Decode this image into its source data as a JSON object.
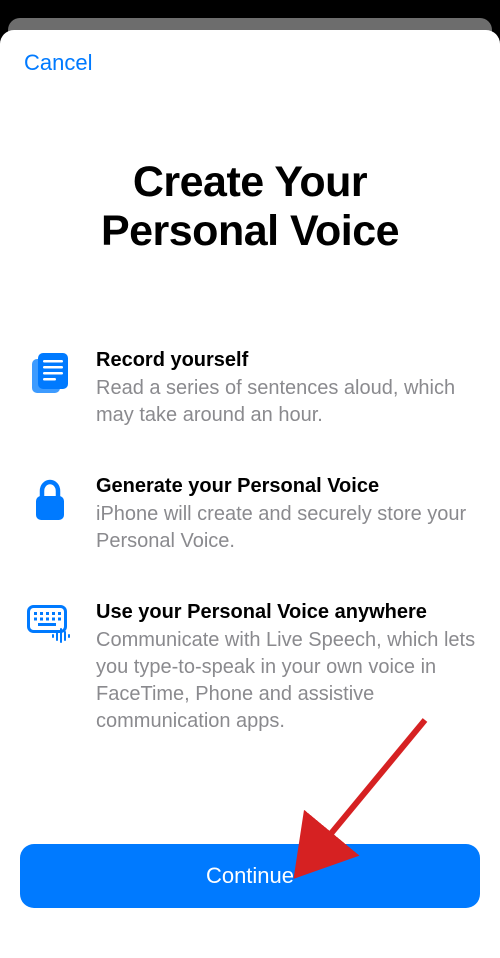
{
  "nav": {
    "cancel_label": "Cancel"
  },
  "title_line1": "Create Your",
  "title_line2": "Personal Voice",
  "features": {
    "record": {
      "title": "Record yourself",
      "desc": "Read a series of sentences aloud, which may take around an hour."
    },
    "generate": {
      "title": "Generate your Personal Voice",
      "desc": "iPhone will create and securely store your Personal Voice."
    },
    "use": {
      "title": "Use your Personal Voice anywhere",
      "desc": "Communicate with Live Speech, which lets you type-to-speak in your own voice in FaceTime, Phone and assistive communication apps."
    }
  },
  "continue_label": "Continue",
  "colors": {
    "accent": "#007aff",
    "secondary_text": "#8a8a8e"
  }
}
